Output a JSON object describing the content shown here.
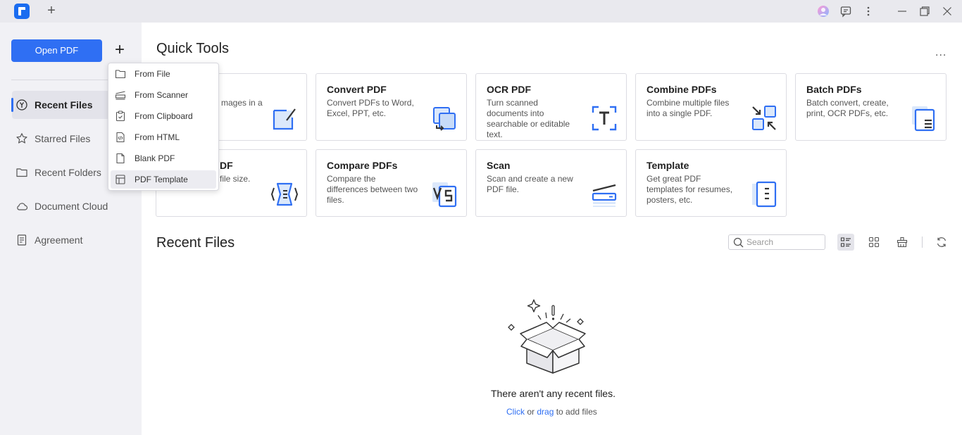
{
  "titlebar": {
    "new_tab_label": "+"
  },
  "sidebar": {
    "open_pdf_label": "Open PDF",
    "add_label": "+",
    "items": [
      {
        "label": "Recent Files",
        "active": true
      },
      {
        "label": "Starred Files"
      },
      {
        "label": "Recent Folders"
      },
      {
        "label": "Document Cloud"
      },
      {
        "label": "Agreement"
      }
    ]
  },
  "dropdown": {
    "items": [
      {
        "label": "From File",
        "icon": "folder-icon"
      },
      {
        "label": "From Scanner",
        "icon": "scanner-icon"
      },
      {
        "label": "From Clipboard",
        "icon": "clipboard-icon"
      },
      {
        "label": "From HTML",
        "icon": "html-file-icon"
      },
      {
        "label": "Blank PDF",
        "icon": "blank-page-icon"
      },
      {
        "label": "PDF Template",
        "icon": "template-icon",
        "hover": true
      }
    ]
  },
  "quick_tools": {
    "title": "Quick Tools",
    "more_label": "...",
    "cards": [
      {
        "title": "",
        "desc": "mages in a",
        "icon": "edit-pdf-icon"
      },
      {
        "title": "Convert PDF",
        "desc": "Convert PDFs to Word, Excel, PPT, etc.",
        "icon": "convert-icon"
      },
      {
        "title": "OCR PDF",
        "desc": "Turn scanned documents into searchable or editable text.",
        "icon": "ocr-icon"
      },
      {
        "title": "Combine PDFs",
        "desc": "Combine multiple files into a single PDF.",
        "icon": "combine-icon"
      },
      {
        "title": "Batch PDFs",
        "desc": "Batch convert, create, print, OCR PDFs, etc.",
        "icon": "batch-icon"
      },
      {
        "title": "DF",
        "desc": "file size.",
        "icon": "compress-icon"
      },
      {
        "title": "Compare PDFs",
        "desc": "Compare the differences between two files.",
        "icon": "compare-icon"
      },
      {
        "title": "Scan",
        "desc": "Scan and create a new PDF file.",
        "icon": "scan-icon"
      },
      {
        "title": "Template",
        "desc": "Get great PDF templates for resumes, posters, etc.",
        "icon": "template-icon"
      }
    ]
  },
  "recent_files": {
    "title": "Recent Files",
    "search_placeholder": "Search",
    "empty_message": "There aren't any recent files.",
    "hint_click": "Click",
    "hint_or": " or ",
    "hint_drag": "drag",
    "hint_suffix": " to add files"
  },
  "colors": {
    "accent": "#2f6ff3",
    "sidebar_bg": "#f1f1f5",
    "titlebar_bg": "#e9e9ee"
  }
}
